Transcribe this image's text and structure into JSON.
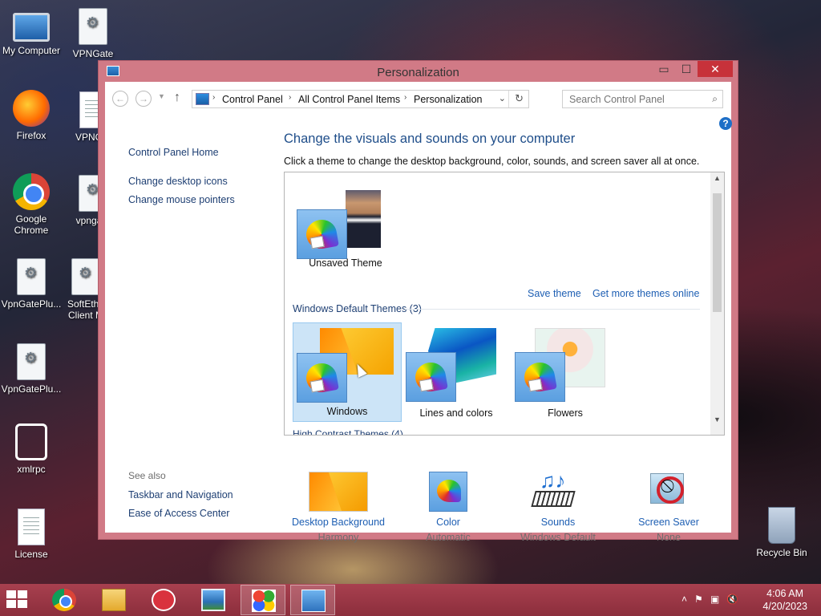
{
  "desktop": {
    "icons": [
      {
        "label": "My Computer"
      },
      {
        "label": "VPNGate"
      },
      {
        "label": "Firefox"
      },
      {
        "label": "VPNGat"
      },
      {
        "label": "Google Chrome"
      },
      {
        "label": "vpngate"
      },
      {
        "label": "VpnGatePlu..."
      },
      {
        "label": "SoftEthe Client M"
      },
      {
        "label": "VpnGatePlu..."
      },
      {
        "label": "xmlrpc"
      },
      {
        "label": "License"
      },
      {
        "label": "Recycle Bin"
      }
    ]
  },
  "window": {
    "title": "Personalization",
    "min_glyph": "▭",
    "max_glyph": "☐",
    "close_glyph": "✕"
  },
  "nav": {
    "back_glyph": "←",
    "forward_glyph": "→",
    "recent_glyph": "▼",
    "up_glyph": "↑",
    "breadcrumb": [
      "Control Panel",
      "All Control Panel Items",
      "Personalization"
    ],
    "separator": "›",
    "dropdown_glyph": "⌄",
    "refresh_glyph": "↻",
    "search_placeholder": "Search Control Panel",
    "search_glyph": "⌕"
  },
  "left_pane": {
    "home": "Control Panel Home",
    "links": [
      "Change desktop icons",
      "Change mouse pointers"
    ],
    "see_also_title": "See also",
    "see_also": [
      "Taskbar and Navigation",
      "Ease of Access Center"
    ]
  },
  "help_glyph": "?",
  "main": {
    "heading": "Change the visuals and sounds on your computer",
    "subheading": "Click a theme to change the desktop background, color, sounds, and screen saver all at once.",
    "unsaved_theme_label": "Unsaved Theme",
    "save_theme": "Save theme",
    "get_more": "Get more themes online",
    "default_header": "Windows Default Themes (3)",
    "themes": [
      {
        "label": "Windows",
        "selected": true
      },
      {
        "label": "Lines and colors",
        "selected": false
      },
      {
        "label": "Flowers",
        "selected": false
      }
    ],
    "hc_peek": "High Contrast Themes (4)",
    "scroll_up_glyph": "▲",
    "scroll_down_glyph": "▼"
  },
  "settings": [
    {
      "label": "Desktop Background",
      "value": "Harmony"
    },
    {
      "label": "Color",
      "value": "Automatic"
    },
    {
      "label": "Sounds",
      "value": "Windows Default"
    },
    {
      "label": "Screen Saver",
      "value": "None"
    }
  ],
  "taskbar": {
    "clock_time": "4:06 AM",
    "clock_date": "4/20/2023",
    "tray_glyphs": [
      "˄",
      "⚑",
      "▣",
      "🔇"
    ],
    "accent": "#9b3545"
  }
}
